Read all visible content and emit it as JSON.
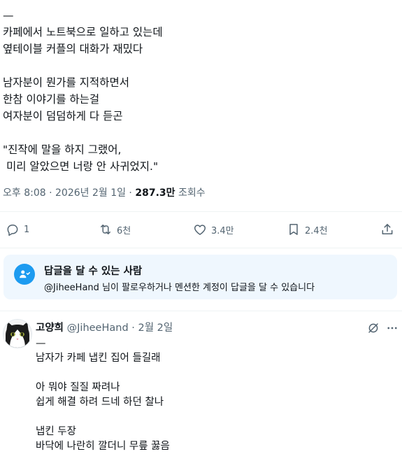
{
  "post": {
    "lines": [
      "—",
      "카페에서 노트북으로 일하고 있는데",
      "옆테이블 커플의 대화가 재밌다",
      "",
      "남자분이 뭔가를 지적하면서",
      "한참 이야기를 하는걸",
      "여자분이 덤덤하게 다 듣곤",
      "",
      "\"진작에 말을 하지 그랬어,",
      " 미리 알았으면 너랑 안 사귀었지.\""
    ],
    "timestamp": "오후 8:08 · 2026년 2월 1일",
    "separator": " · ",
    "views_count": "287.3만",
    "views_label": " 조회수"
  },
  "actions": {
    "replies": "1",
    "reposts": "6천",
    "likes": "3.4만",
    "bookmarks": "2.4천"
  },
  "reply_restriction": {
    "title": "답글을 달 수 있는 사람",
    "description": "@JiheeHand 님이 팔로우하거나 멘션한 계정이 답글을 달 수 있습니다"
  },
  "reply": {
    "name": "고양희",
    "handle": "@JiheeHand",
    "separator": " · ",
    "date": "2월 2일",
    "lines": [
      "—",
      "남자가 카페 냅킨 집어 들길래",
      "",
      "아 뭐야 질질 짜려나",
      "쉽게 해결 하려 드네 하던 찰나",
      "",
      "냅킨 두장",
      "바닥에 나란히 깔더니 무릎 꿇음"
    ]
  },
  "colors": {
    "accent": "#1d9bf0",
    "text_secondary": "#536471",
    "restriction_bg": "#eff7fe"
  }
}
